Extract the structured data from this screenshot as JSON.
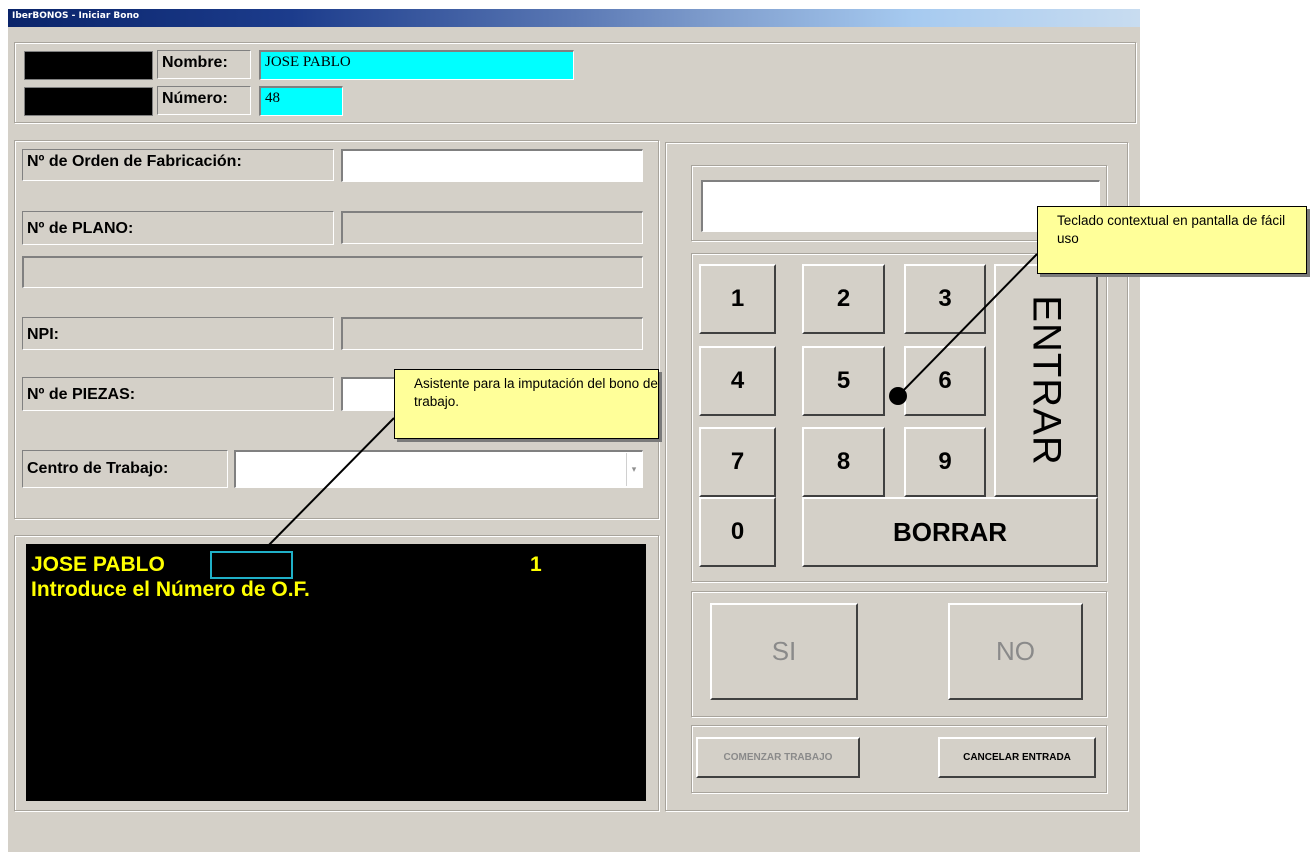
{
  "window": {
    "title": "IberBONOS - Iniciar Bono"
  },
  "header": {
    "nombre_label": "Nombre:",
    "nombre_value": "JOSE PABLO",
    "numero_label": "Número:",
    "numero_value": "48"
  },
  "form": {
    "orden_label": "Nº de Orden de Fabricación:",
    "orden_value": "",
    "plano_label": "Nº de PLANO:",
    "npi_label": "NPI:",
    "piezas_label": "Nº de PIEZAS:",
    "centro_label": "Centro de Trabajo:",
    "centro_value": ""
  },
  "console": {
    "line1_name": "JOSE PABLO",
    "line1_step": "1",
    "line2": "Introduce el Número de O.F."
  },
  "keypad": {
    "display_value": "",
    "keys": [
      "1",
      "2",
      "3",
      "4",
      "5",
      "6",
      "7",
      "8",
      "9",
      "0"
    ],
    "enter_label": "ENTRAR",
    "clear_label": "BORRAR"
  },
  "confirm": {
    "yes_label": "SI",
    "no_label": "NO"
  },
  "actions": {
    "start_label": "COMENZAR TRABAJO",
    "cancel_label": "CANCELAR ENTRADA"
  },
  "callouts": {
    "wizard": "Asistente para la imputación del bono de trabajo.",
    "keypad": "Teclado contextual en pantalla de fácil uso"
  },
  "colors": {
    "highlight_field": "#00ffff",
    "console_text": "#ffff00",
    "callout_bg": "#ffff99"
  }
}
